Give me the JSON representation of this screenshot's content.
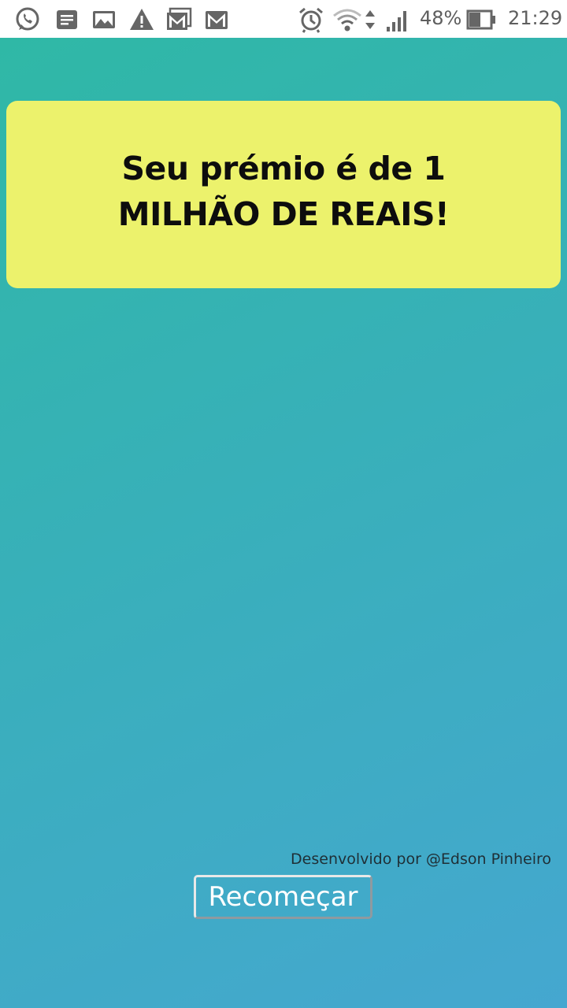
{
  "status_bar": {
    "battery": "48%",
    "time": "21:29",
    "icons": [
      "whatsapp-icon",
      "notes-icon",
      "gallery-icon",
      "warning-icon",
      "gmail-icon",
      "gmail-icon",
      "alarm-icon",
      "wifi-icon",
      "signal-icon",
      "battery-icon"
    ]
  },
  "prize": {
    "line1": "Seu prémio é de 1",
    "line2": "MILHÃO DE REAIS!"
  },
  "footer": {
    "credit": "Desenvolvido por @Edson Pinheiro",
    "restart_label": "Recomeçar"
  },
  "colors": {
    "card": "#ecf26c",
    "gradient_start": "#2fb8a6",
    "gradient_end": "#45a7d0"
  }
}
